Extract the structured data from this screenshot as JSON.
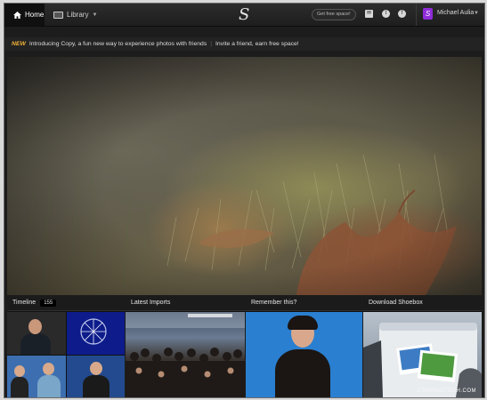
{
  "topbar": {
    "home_label": "Home",
    "library_label": "Library",
    "logo_text": "S",
    "free_space_label": "Get free space!",
    "user_initial": "S",
    "user_name": "Michael Aulia"
  },
  "notice": {
    "badge": "NEW",
    "text": "Introducing Copy, a fun new way to experience photos with friends",
    "divider": "|",
    "link": "Invite a friend, earn free space!"
  },
  "tiles": [
    {
      "title": "Timeline",
      "count": "155"
    },
    {
      "title": "Latest Imports"
    },
    {
      "title": "Remember this?"
    },
    {
      "title": "Download Shoebox"
    }
  ],
  "watermark": "CRAVINGTECH.COM",
  "colors": {
    "accent_purple": "#8f2bd8",
    "new_badge": "#f2b234",
    "background": "#1c1c1c"
  }
}
